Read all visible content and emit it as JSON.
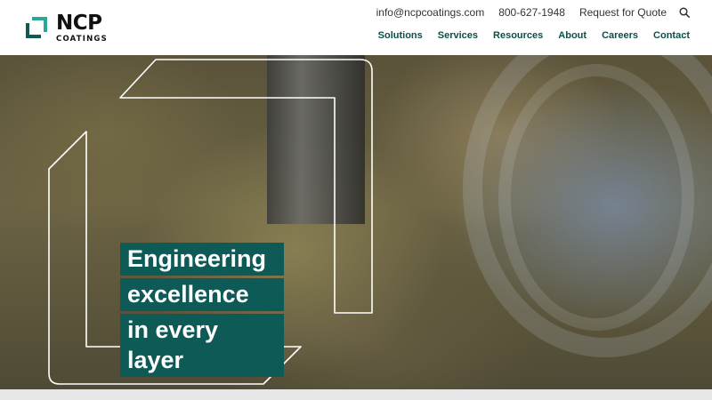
{
  "brand": {
    "name": "NCP",
    "sub": "COATINGS",
    "accent": "#0e5a56",
    "nav_color": "#0d4f4a"
  },
  "utility": {
    "email": "info@ncpcoatings.com",
    "phone": "800-627-1948",
    "quote": "Request for Quote",
    "search_icon": "search-icon"
  },
  "nav": {
    "items": [
      "Solutions",
      "Services",
      "Resources",
      "About",
      "Careers",
      "Contact"
    ]
  },
  "hero": {
    "line1": "Engineering",
    "line2": "excellence",
    "line3": "in every layer"
  }
}
